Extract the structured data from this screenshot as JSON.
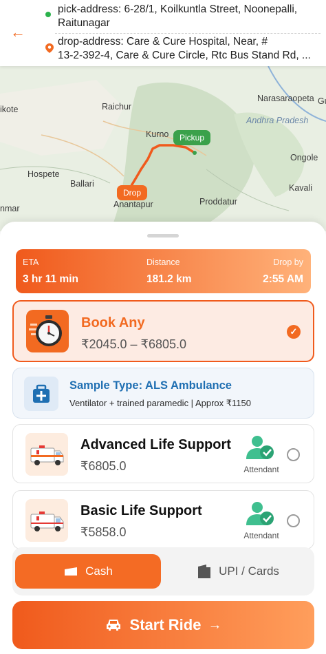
{
  "header": {
    "pick_address": "pick-address: 6-28/1, Koilkuntla Street, Noonepalli,",
    "pick_address_line2": "Raitunagar",
    "drop_address": "drop-address: Care & Cure Hospital, Near, #",
    "drop_address_line2": "13-2-392-4, Care & Cure Circle, Rtc Bus Stand Rd, ..."
  },
  "map": {
    "labels": {
      "raichur": "Raichur",
      "kurnool": "Kurno",
      "narasaraopeta": "Narasaraopeta",
      "andhra": "Andhra Pradesh",
      "ongole": "Ongole",
      "hospete": "Hospete",
      "ballari": "Ballari",
      "proddatur": "Proddatur",
      "anantapur": "Anantapur",
      "kavali": "Kavali",
      "ilkote": "ikote",
      "gu": "Gu",
      "nmar": "nmar"
    },
    "pickup_tag": "Pickup",
    "drop_tag": "Drop"
  },
  "eta": {
    "eta_label": "ETA",
    "eta_value": "3 hr 11 min",
    "distance_label": "Distance",
    "distance_value": "181.2 km",
    "dropby_label": "Drop by",
    "dropby_value": "2:55 AM"
  },
  "book_any": {
    "title": "Book Any",
    "price_range": "₹2045.0 – ₹6805.0"
  },
  "sample": {
    "title": "Sample Type: ALS Ambulance",
    "subtitle": "Ventilator + trained paramedic | Approx ₹1150"
  },
  "options": [
    {
      "name": "Advanced Life Support",
      "price": "₹6805.0",
      "attendant_label": "Attendant"
    },
    {
      "name": "Basic Life Support",
      "price": "₹5858.0",
      "attendant_label": "Attendant"
    }
  ],
  "payment": {
    "cash_label": "Cash",
    "upi_label": "UPI / Cards"
  },
  "cta": {
    "label": "Start Ride",
    "arrow": "→"
  },
  "colors": {
    "accent": "#f26a21",
    "pickup_green": "#3aa14b",
    "info_blue": "#1f6fb2"
  }
}
